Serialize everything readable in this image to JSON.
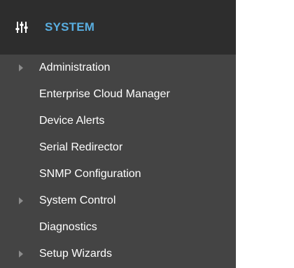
{
  "header": {
    "title": "SYSTEM",
    "icon": "sliders-icon"
  },
  "menu": {
    "items": [
      {
        "label": "Administration",
        "expandable": true
      },
      {
        "label": "Enterprise Cloud Manager",
        "expandable": false
      },
      {
        "label": "Device Alerts",
        "expandable": false
      },
      {
        "label": "Serial Redirector",
        "expandable": false
      },
      {
        "label": "SNMP Configuration",
        "expandable": false
      },
      {
        "label": "System Control",
        "expandable": true
      },
      {
        "label": "Diagnostics",
        "expandable": false
      },
      {
        "label": "Setup Wizards",
        "expandable": true
      }
    ]
  },
  "colors": {
    "header_bg": "#2d2d2d",
    "menu_bg": "#444444",
    "accent": "#59aee0",
    "caret": "#8c8c8c"
  }
}
